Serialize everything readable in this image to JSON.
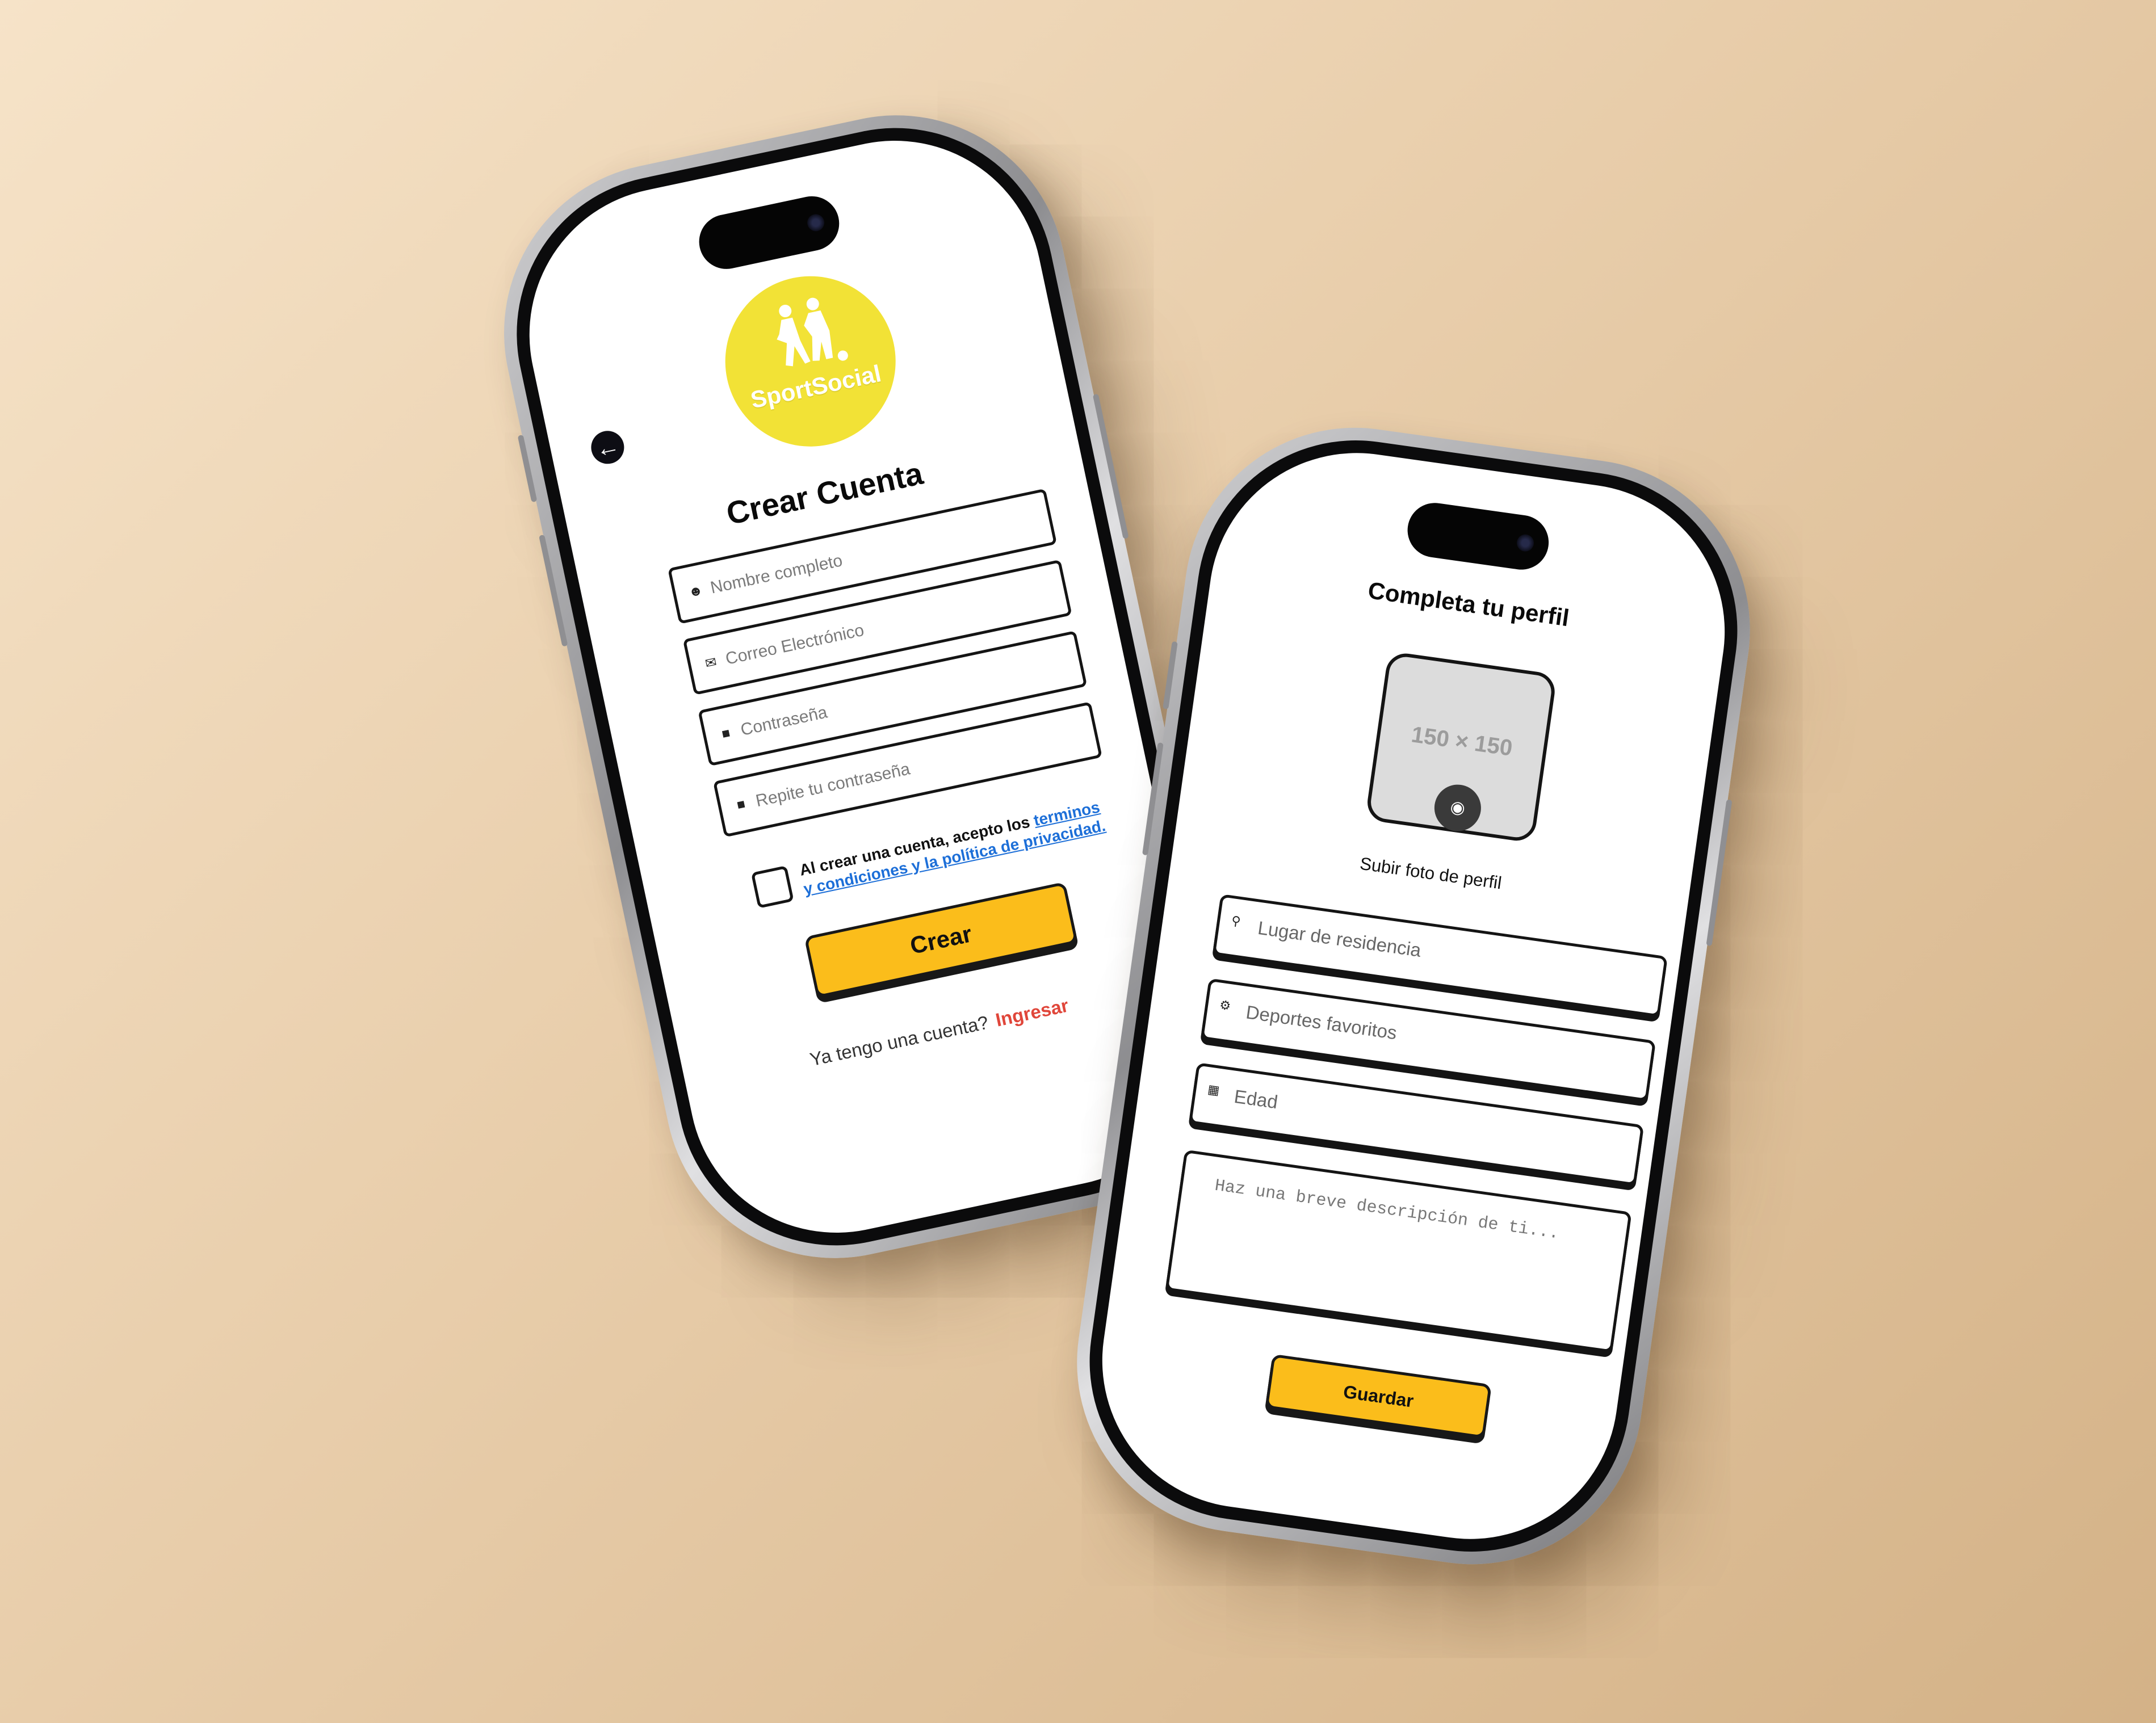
{
  "signup": {
    "logo_text": "SportSocial",
    "title": "Crear Cuenta",
    "fields": [
      {
        "icon": "user-icon",
        "placeholder": "Nombre completo"
      },
      {
        "icon": "envelope-icon",
        "placeholder": "Correo Electrónico"
      },
      {
        "icon": "lock-icon",
        "placeholder": "Contraseña"
      },
      {
        "icon": "lock-icon",
        "placeholder": "Repite tu contraseña"
      }
    ],
    "terms_prefix": "Al crear una cuenta, acepto los ",
    "terms_link_1": "terminos",
    "terms_link_2": "y condiciones y la política de privacidad.",
    "create_label": "Crear",
    "have_account": "Ya tengo una cuenta?",
    "login_link": "Ingresar"
  },
  "profile": {
    "title": "Completa tu perfil",
    "photo_placeholder": "150 × 150",
    "photo_caption": "Subir foto de perfil",
    "fields": [
      {
        "icon": "location-pin-icon",
        "placeholder": "Lugar de residencia"
      },
      {
        "icon": "ball-icon",
        "placeholder": "Deportes favoritos"
      },
      {
        "icon": "calendar-icon",
        "placeholder": "Edad"
      }
    ],
    "description_placeholder": "Haz una breve descripción de ti...",
    "save_label": "Guardar"
  },
  "colors": {
    "accent_yellow": "#fbbd1b",
    "logo_yellow": "#f2e236",
    "link_blue": "#1d6fd8",
    "login_red": "#e0463a"
  }
}
